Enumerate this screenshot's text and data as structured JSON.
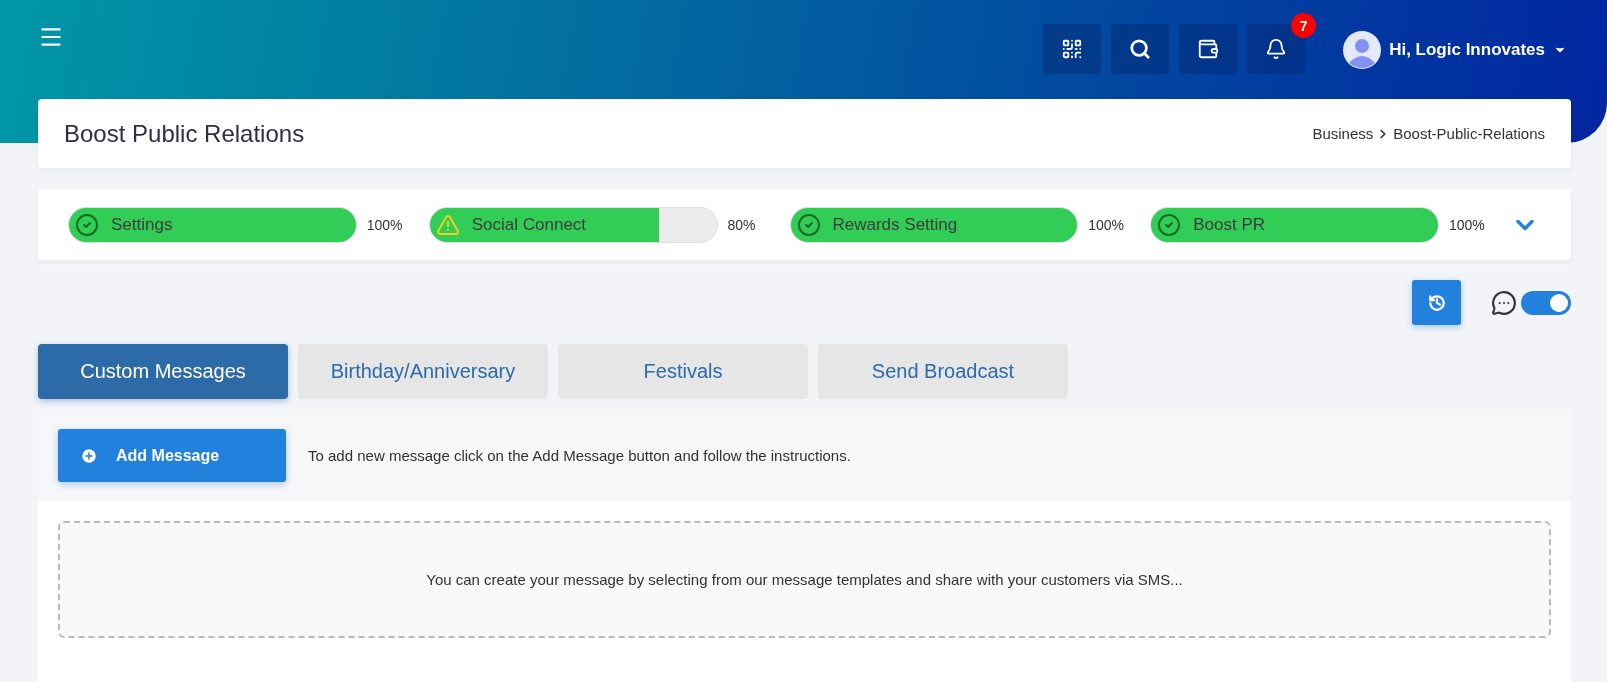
{
  "header": {
    "notifications": {
      "count": "7"
    },
    "user": {
      "greeting": "Hi, Logic Innovates"
    }
  },
  "page": {
    "title": "Boost Public Relations",
    "breadcrumb": [
      "Business",
      "Boost-Public-Relations"
    ]
  },
  "progress": [
    {
      "label": "Settings",
      "kind": "complete",
      "level": 1,
      "reading": "100%"
    },
    {
      "label": "Social Connect",
      "kind": "warning",
      "level": 0.8,
      "reading": "80%"
    },
    {
      "label": "Rewards Setting",
      "kind": "complete",
      "level": 1,
      "reading": "100%"
    },
    {
      "label": "Boost PR",
      "kind": "complete",
      "level": 1,
      "reading": "100%"
    }
  ],
  "chat_toggle": {
    "on": true
  },
  "tabs": [
    {
      "label": "Custom Messages",
      "selected": true
    },
    {
      "label": "Birthday/Anniversary",
      "selected": false
    },
    {
      "label": "Festivals",
      "selected": false
    },
    {
      "label": "Send Broadcast",
      "selected": false
    }
  ],
  "add_message": {
    "button": "Add Message",
    "hint": "To add new message click on the Add Message button and follow the instructions."
  },
  "empty_state": "You can create your message by selecting from our message templates and share with your customers via SMS..."
}
